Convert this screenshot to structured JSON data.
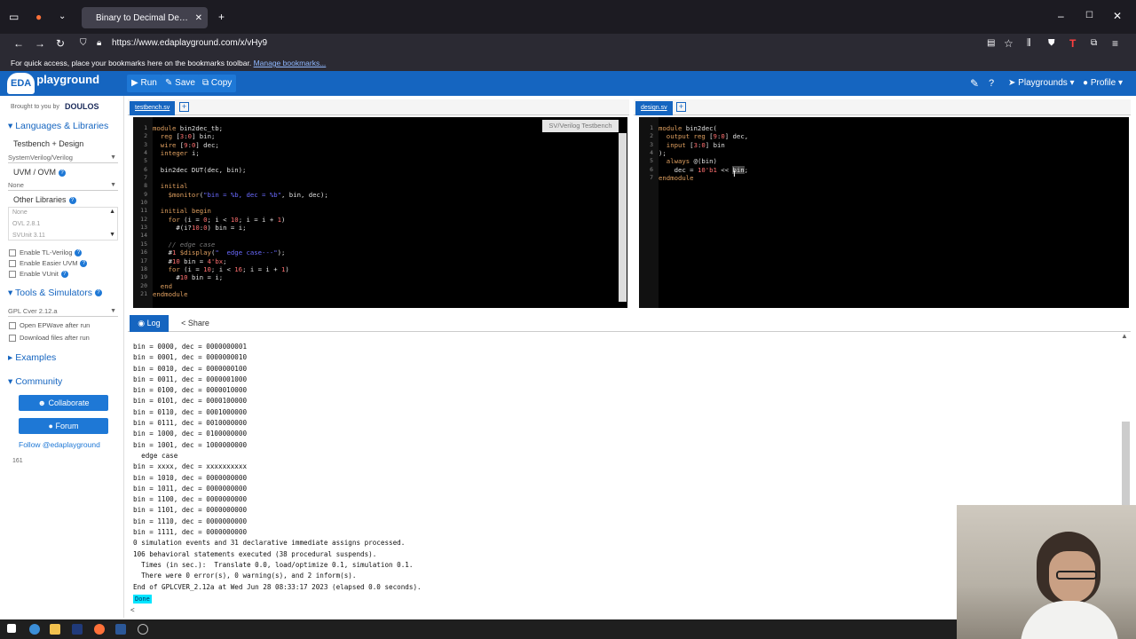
{
  "browser": {
    "tab_title": "Binary to Decimal Decoder - ED",
    "url": "https://www.edaplayground.com/x/vHy9",
    "bookmarks_text": "For quick access, place your bookmarks here on the bookmarks toolbar.",
    "bookmarks_link": "Manage bookmarks..."
  },
  "header": {
    "logo_eda": "EDA",
    "logo_playground": "playground",
    "run": "Run",
    "save": "Save",
    "copy": "Copy",
    "playgrounds": "Playgrounds",
    "profile": "Profile"
  },
  "sidebar": {
    "brought_by": "Brought to you by",
    "doulos": "DOULOS",
    "languages": "Languages & Libraries",
    "testbench_design": "Testbench + Design",
    "language_value": "SystemVerilog/Verilog",
    "uvm_label": "UVM / OVM",
    "uvm_value": "None",
    "other_libraries": "Other Libraries",
    "lib_items": [
      "None",
      "OVL 2.8.1",
      "SVUnit 3.11"
    ],
    "cb_tl": "Enable TL-Verilog",
    "cb_easier": "Enable Easier UVM",
    "cb_vunit": "Enable VUnit",
    "tools": "Tools & Simulators",
    "tool_value": "GPL Cver 2.12.a",
    "cb_epwave": "Open EPWave after run",
    "cb_download": "Download files after run",
    "examples": "Examples",
    "community": "Community",
    "collaborate": "Collaborate",
    "forum": "Forum",
    "follow": "Follow @edaplayground",
    "count": "161"
  },
  "left_editor": {
    "tab": "testbench.sv",
    "label": "SV/Verilog Testbench",
    "line_numbers": "1\n2\n3\n4\n5\n6\n7\n8\n9\n10\n11\n12\n13\n14\n15\n16\n17\n18\n19\n20\n21"
  },
  "right_editor": {
    "tab": "design.sv",
    "line_numbers": "1\n2\n3\n4\n5\n6\n7"
  },
  "log": {
    "tab_log": "Log",
    "tab_share": "Share",
    "lines": [
      "bin = 0000, dec = 0000000001",
      "bin = 0001, dec = 0000000010",
      "bin = 0010, dec = 0000000100",
      "bin = 0011, dec = 0000001000",
      "bin = 0100, dec = 0000010000",
      "bin = 0101, dec = 0000100000",
      "bin = 0110, dec = 0001000000",
      "bin = 0111, dec = 0010000000",
      "bin = 1000, dec = 0100000000",
      "bin = 1001, dec = 1000000000",
      "  edge case",
      "bin = xxxx, dec = xxxxxxxxxx",
      "bin = 1010, dec = 0000000000",
      "bin = 1011, dec = 0000000000",
      "bin = 1100, dec = 0000000000",
      "bin = 1101, dec = 0000000000",
      "bin = 1110, dec = 0000000000",
      "bin = 1111, dec = 0000000000",
      "0 simulation events and 31 declarative immediate assigns processed.",
      "106 behavioral statements executed (38 procedural suspends).",
      "  Times (in sec.):  Translate 0.0, load/optimize 0.1, simulation 0.1.",
      "  There were 0 error(s), 0 warning(s), and 2 inform(s).",
      "End of GPLCVER_2.12a at Wed Jun 28 08:33:17 2023 (elapsed 0.0 seconds)."
    ],
    "done": "Done",
    "prompt": "<"
  },
  "icons": {
    "firefox": "firefox-icon",
    "search": "search-icon"
  },
  "colors": {
    "brand_blue": "#1565c0",
    "editor_bg": "#000000",
    "done_bg": "#00e5ff"
  }
}
